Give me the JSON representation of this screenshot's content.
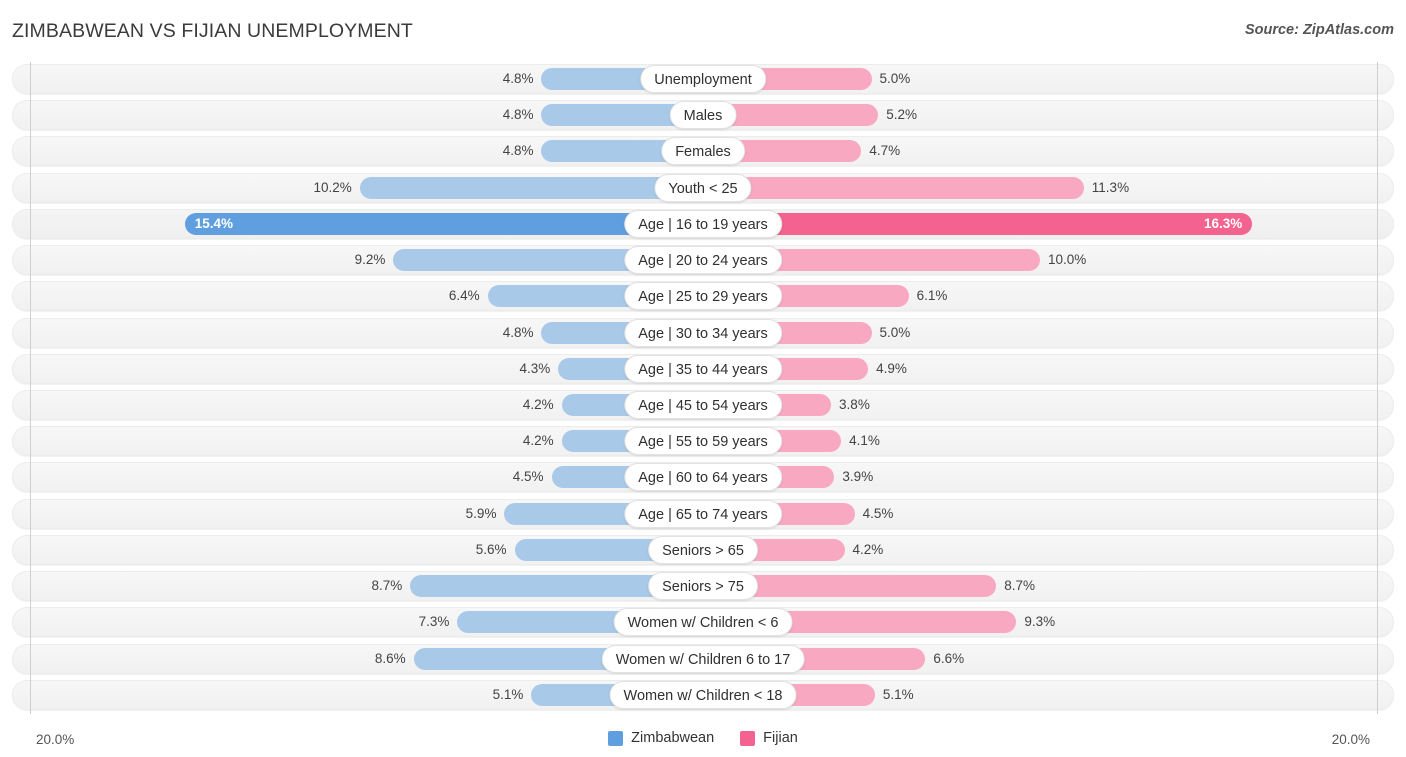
{
  "header": {
    "title": "ZIMBABWEAN VS FIJIAN UNEMPLOYMENT",
    "source": "Source: ZipAtlas.com"
  },
  "axis": {
    "left_tick": "20.0%",
    "right_tick": "20.0%",
    "max": 20.0
  },
  "legend": [
    {
      "label": "Zimbabwean",
      "color": "#5f9fdf"
    },
    {
      "label": "Fijian",
      "color": "#f4628f"
    }
  ],
  "colors": {
    "left_bar": "#a8c9e8",
    "right_bar": "#f9a8c2",
    "left_bar_highlight": "#5f9fdf",
    "right_bar_highlight": "#f4628f",
    "track": "#f4f4f4"
  },
  "chart_data": {
    "type": "bar",
    "title": "ZIMBABWEAN VS FIJIAN UNEMPLOYMENT",
    "subtitle": "",
    "xlabel": "",
    "ylabel": "",
    "orientation": "horizontal-diverging",
    "xlim": [
      0,
      20
    ],
    "grid": false,
    "legend_position": "bottom-center",
    "categories": [
      "Unemployment",
      "Males",
      "Females",
      "Youth < 25",
      "Age | 16 to 19 years",
      "Age | 20 to 24 years",
      "Age | 25 to 29 years",
      "Age | 30 to 34 years",
      "Age | 35 to 44 years",
      "Age | 45 to 54 years",
      "Age | 55 to 59 years",
      "Age | 60 to 64 years",
      "Age | 65 to 74 years",
      "Seniors > 65",
      "Seniors > 75",
      "Women w/ Children < 6",
      "Women w/ Children 6 to 17",
      "Women w/ Children < 18"
    ],
    "series": [
      {
        "name": "Zimbabwean",
        "color": "#5f9fdf",
        "values": [
          4.8,
          4.8,
          4.8,
          10.2,
          15.4,
          9.2,
          6.4,
          4.8,
          4.3,
          4.2,
          4.2,
          4.5,
          5.9,
          5.6,
          8.7,
          7.3,
          8.6,
          5.1
        ]
      },
      {
        "name": "Fijian",
        "color": "#f4628f",
        "values": [
          5.0,
          5.2,
          4.7,
          11.3,
          16.3,
          10.0,
          6.1,
          5.0,
          4.9,
          3.8,
          4.1,
          3.9,
          4.5,
          4.2,
          8.7,
          9.3,
          6.6,
          5.1
        ]
      }
    ],
    "highlight_row_index": 4
  },
  "rows": [
    {
      "label": "Unemployment",
      "left": 4.8,
      "right": 5.0,
      "left_text": "4.8%",
      "right_text": "5.0%",
      "highlight": false
    },
    {
      "label": "Males",
      "left": 4.8,
      "right": 5.2,
      "left_text": "4.8%",
      "right_text": "5.2%",
      "highlight": false
    },
    {
      "label": "Females",
      "left": 4.8,
      "right": 4.7,
      "left_text": "4.8%",
      "right_text": "4.7%",
      "highlight": false
    },
    {
      "label": "Youth < 25",
      "left": 10.2,
      "right": 11.3,
      "left_text": "10.2%",
      "right_text": "11.3%",
      "highlight": false
    },
    {
      "label": "Age | 16 to 19 years",
      "left": 15.4,
      "right": 16.3,
      "left_text": "15.4%",
      "right_text": "16.3%",
      "highlight": true
    },
    {
      "label": "Age | 20 to 24 years",
      "left": 9.2,
      "right": 10.0,
      "left_text": "9.2%",
      "right_text": "10.0%",
      "highlight": false
    },
    {
      "label": "Age | 25 to 29 years",
      "left": 6.4,
      "right": 6.1,
      "left_text": "6.4%",
      "right_text": "6.1%",
      "highlight": false
    },
    {
      "label": "Age | 30 to 34 years",
      "left": 4.8,
      "right": 5.0,
      "left_text": "4.8%",
      "right_text": "5.0%",
      "highlight": false
    },
    {
      "label": "Age | 35 to 44 years",
      "left": 4.3,
      "right": 4.9,
      "left_text": "4.3%",
      "right_text": "4.9%",
      "highlight": false
    },
    {
      "label": "Age | 45 to 54 years",
      "left": 4.2,
      "right": 3.8,
      "left_text": "4.2%",
      "right_text": "3.8%",
      "highlight": false
    },
    {
      "label": "Age | 55 to 59 years",
      "left": 4.2,
      "right": 4.1,
      "left_text": "4.2%",
      "right_text": "4.1%",
      "highlight": false
    },
    {
      "label": "Age | 60 to 64 years",
      "left": 4.5,
      "right": 3.9,
      "left_text": "4.5%",
      "right_text": "3.9%",
      "highlight": false
    },
    {
      "label": "Age | 65 to 74 years",
      "left": 5.9,
      "right": 4.5,
      "left_text": "5.9%",
      "right_text": "4.5%",
      "highlight": false
    },
    {
      "label": "Seniors > 65",
      "left": 5.6,
      "right": 4.2,
      "left_text": "5.6%",
      "right_text": "4.2%",
      "highlight": false
    },
    {
      "label": "Seniors > 75",
      "left": 8.7,
      "right": 8.7,
      "left_text": "8.7%",
      "right_text": "8.7%",
      "highlight": false
    },
    {
      "label": "Women w/ Children < 6",
      "left": 7.3,
      "right": 9.3,
      "left_text": "7.3%",
      "right_text": "9.3%",
      "highlight": false
    },
    {
      "label": "Women w/ Children 6 to 17",
      "left": 8.6,
      "right": 6.6,
      "left_text": "8.6%",
      "right_text": "6.6%",
      "highlight": false
    },
    {
      "label": "Women w/ Children < 18",
      "left": 5.1,
      "right": 5.1,
      "left_text": "5.1%",
      "right_text": "5.1%",
      "highlight": false
    }
  ]
}
